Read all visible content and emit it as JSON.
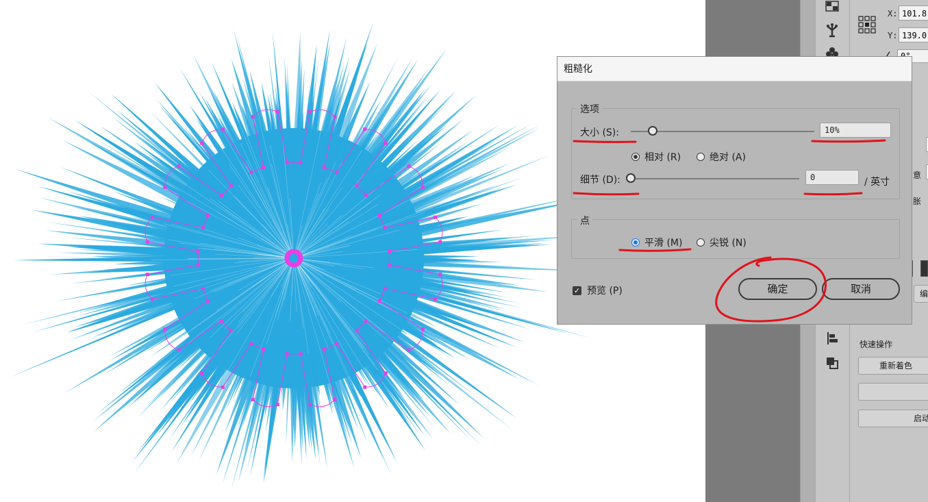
{
  "dialog": {
    "title": "粗糙化",
    "options_group": "选项",
    "size_label": "大小 (S):",
    "size_value": "10%",
    "size_slider_fraction": 0.12,
    "relative_label": "相对 (R)",
    "absolute_label": "绝对 (A)",
    "detail_label": "细节 (D):",
    "detail_value": "0",
    "detail_slider_fraction": 0.0,
    "detail_unit": "/ 英寸",
    "points_group": "点",
    "smooth_label": "平滑 (M)",
    "corner_label": "尖锐 (N)",
    "preview_label": "预览 (P)",
    "ok_label": "确定",
    "cancel_label": "取消"
  },
  "properties": {
    "x_label": "X:",
    "x_value": "101.8",
    "y_label": "Y:",
    "y_value": "139.0",
    "angle_value": "0°",
    "snippet_1": "意",
    "snippet_2": "胀",
    "snippet_3": "编",
    "quick_actions": "快速操作",
    "recolor_button": "重新着色",
    "launch_button": "启动"
  },
  "colors": {
    "starburst": "#29a9df",
    "anchor_points": "#e83fe6",
    "annotation": "#e0121a",
    "dialog_bg": "#b7b7b7",
    "workspace_gap": "#7b7b7b"
  },
  "icons": [
    "grid-icon",
    "puppet-warp-icon",
    "club-icon",
    "reference-point-icon",
    "align-icon",
    "pathfinder-icon",
    "checkmark-icon"
  ]
}
